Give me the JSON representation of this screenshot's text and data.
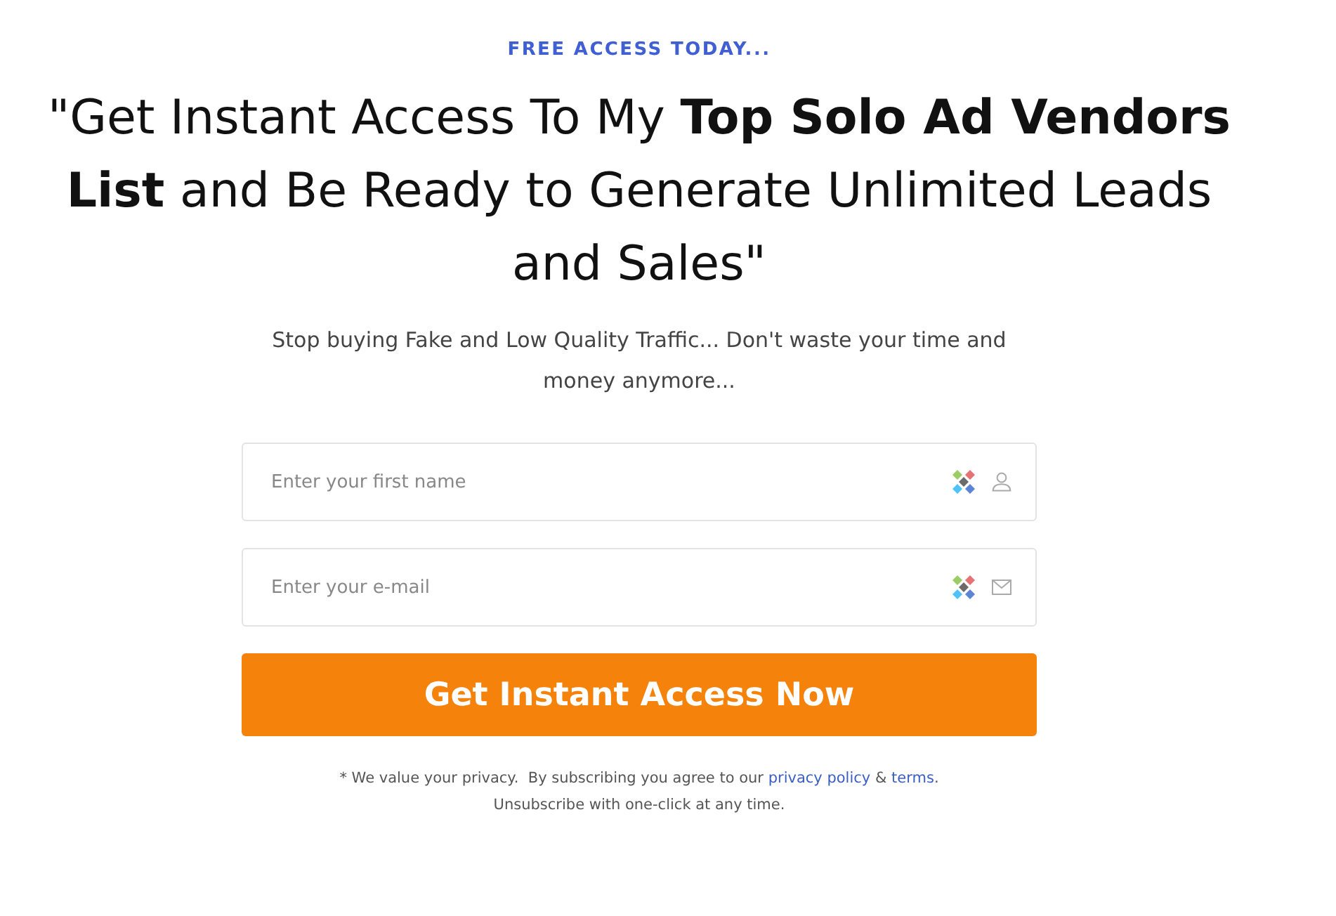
{
  "kicker": "FREE ACCESS TODAY...",
  "headline": "\"Get Instant Access To My **Top Solo Ad Vendors List** and Be Ready to Generate Unlimited Leads and Sales\"",
  "subheadline": "Stop buying Fake and Low Quality Traffic... Don't waste your time and money anymore...",
  "form": {
    "fields": [
      {
        "kind": "name",
        "placeholder": "Enter your first name"
      },
      {
        "kind": "email",
        "placeholder": "Enter your e-mail"
      }
    ],
    "submit": "Get Instant Access Now"
  },
  "privacy": {
    "before": "* We value your privacy.  By subscribing you agree to our",
    "policy_link": "privacy policy",
    "joiner": "&",
    "terms_link": "terms",
    "after": ".",
    "line_2": "Unsubscribe with one-click at any time."
  }
}
